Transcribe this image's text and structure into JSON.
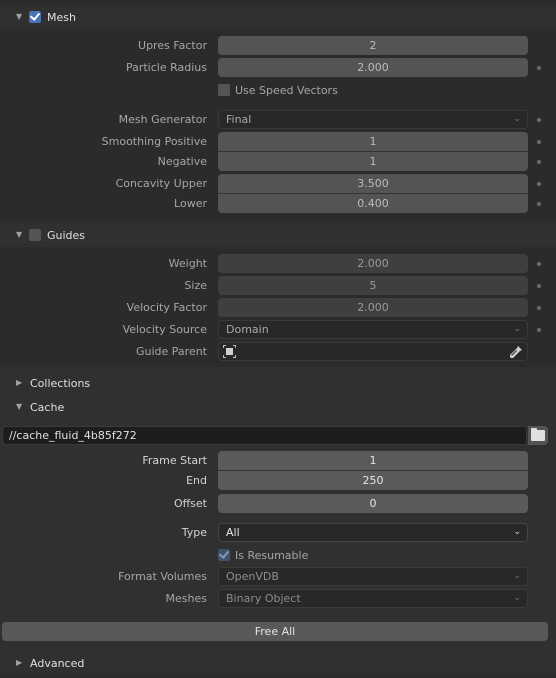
{
  "mesh_panel": {
    "title": "Mesh",
    "enabled": true,
    "upres_factor": {
      "label": "Upres Factor",
      "value": "2"
    },
    "particle_radius": {
      "label": "Particle Radius",
      "value": "2.000"
    },
    "use_speed_vectors": {
      "label": "Use Speed Vectors",
      "checked": false
    },
    "mesh_generator": {
      "label": "Mesh Generator",
      "value": "Final"
    },
    "smoothing_positive": {
      "label": "Smoothing Positive",
      "value": "1"
    },
    "smoothing_negative": {
      "label": "Negative",
      "value": "1"
    },
    "concavity_upper": {
      "label": "Concavity Upper",
      "value": "3.500"
    },
    "concavity_lower": {
      "label": "Lower",
      "value": "0.400"
    }
  },
  "guides_panel": {
    "title": "Guides",
    "enabled": false,
    "weight": {
      "label": "Weight",
      "value": "2.000"
    },
    "size": {
      "label": "Size",
      "value": "5"
    },
    "velocity_factor": {
      "label": "Velocity Factor",
      "value": "2.000"
    },
    "velocity_source": {
      "label": "Velocity Source",
      "value": "Domain"
    },
    "guide_parent": {
      "label": "Guide Parent",
      "value": ""
    }
  },
  "collections_panel": {
    "title": "Collections",
    "expanded": false
  },
  "cache_panel": {
    "title": "Cache",
    "expanded": true,
    "directory": "//cache_fluid_4b85f272",
    "frame_start": {
      "label": "Frame Start",
      "value": "1"
    },
    "frame_end": {
      "label": "End",
      "value": "250"
    },
    "frame_offset": {
      "label": "Offset",
      "value": "0"
    },
    "type": {
      "label": "Type",
      "value": "All"
    },
    "is_resumable": {
      "label": "Is Resumable",
      "checked": true
    },
    "format_volumes": {
      "label": "Format Volumes",
      "value": "OpenVDB"
    },
    "format_meshes": {
      "label": "Meshes",
      "value": "Binary Object"
    },
    "free_all_label": "Free All"
  },
  "advanced_panel": {
    "title": "Advanced",
    "expanded": false
  },
  "colors": {
    "checkbox_on": "#4772b3",
    "background": "#303030",
    "field": "#545454"
  }
}
